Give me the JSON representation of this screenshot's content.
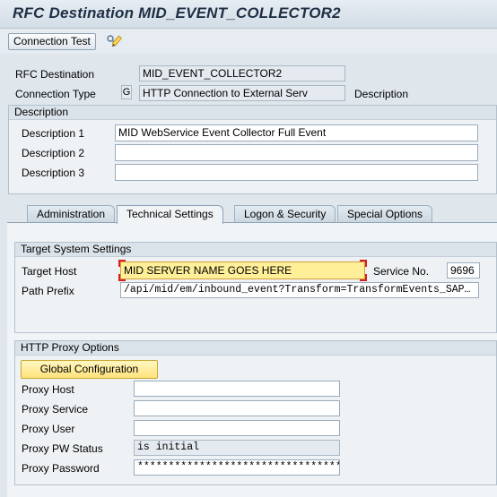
{
  "window": {
    "title": "RFC Destination MID_EVENT_COLLECTOR2"
  },
  "toolbar": {
    "connection_test_label": "Connection Test",
    "edit_icon": "edit-pencil-icon"
  },
  "header": {
    "rfc_destination_label": "RFC Destination",
    "rfc_destination_value": "MID_EVENT_COLLECTOR2",
    "connection_type_label": "Connection Type",
    "connection_type_code": "G",
    "connection_type_value": "HTTP Connection to External Serv",
    "description_label": "Description"
  },
  "description_group": {
    "title": "Description",
    "description1_label": "Description 1",
    "description1_value": "MID WebService Event Collector Full Event",
    "description2_label": "Description 2",
    "description2_value": "",
    "description3_label": "Description 3",
    "description3_value": ""
  },
  "tabs": [
    {
      "label": "Administration"
    },
    {
      "label": "Technical Settings"
    },
    {
      "label": "Logon & Security"
    },
    {
      "label": "Special Options"
    }
  ],
  "target_system": {
    "title": "Target System Settings",
    "target_host_label": "Target Host",
    "target_host_value": "MID SERVER NAME GOES HERE",
    "service_no_label": "Service No.",
    "service_no_value": "9696",
    "path_prefix_label": "Path Prefix",
    "path_prefix_value": "/api/mid/em/inbound_event?Transform=TransformEvents_SAP…"
  },
  "proxy": {
    "title": "HTTP Proxy Options",
    "global_config_label": "Global Configuration",
    "proxy_host_label": "Proxy Host",
    "proxy_host_value": "",
    "proxy_service_label": "Proxy Service",
    "proxy_service_value": "",
    "proxy_user_label": "Proxy User",
    "proxy_user_value": "",
    "proxy_pw_status_label": "Proxy PW Status",
    "proxy_pw_status_value": "is initial",
    "proxy_password_label": "Proxy Password",
    "proxy_password_value": "*********************************"
  },
  "colors": {
    "highlight_field": "#ffef99",
    "highlight_marker": "#d62020",
    "global_config_button": "#ffe27a"
  }
}
